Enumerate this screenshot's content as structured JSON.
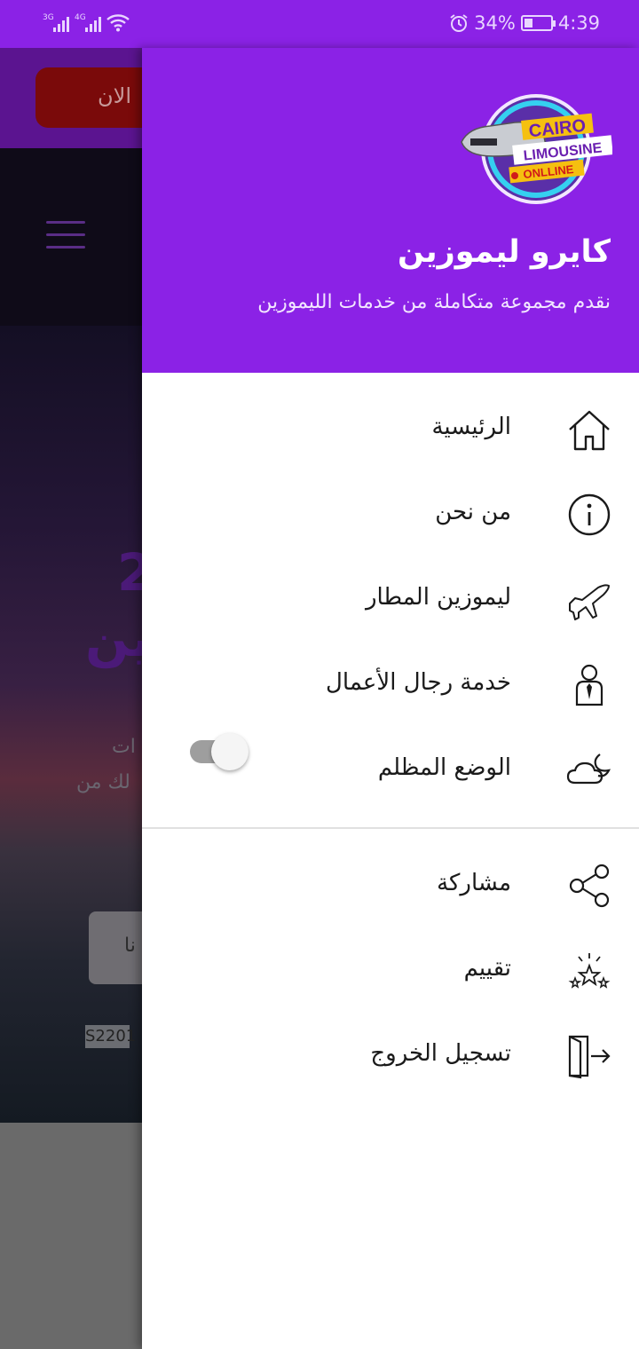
{
  "status_bar": {
    "signal1_type": "3G",
    "signal2_type": "4G",
    "battery_percent": "34%",
    "battery_level": 0.34,
    "time": "4:39"
  },
  "background_app": {
    "cta_text": "الان",
    "hero_partial_1": "2",
    "hero_partial_2": "ين",
    "text_partial_1": "ات",
    "text_partial_2": "لك من",
    "button_partial": "نا",
    "sign_text": "S2201"
  },
  "drawer": {
    "logo": {
      "line1": "CAIRO",
      "line2": "LIMOUSINE",
      "line3": "ONLLINE"
    },
    "title": "كايرو ليموزين",
    "subtitle": "نقدم مجموعة متكاملة من خدمات الليموزين",
    "items": [
      {
        "label": "الرئيسية",
        "icon": "home-icon"
      },
      {
        "label": "من نحن",
        "icon": "info-icon"
      },
      {
        "label": "ليموزين المطار",
        "icon": "airplane-icon"
      },
      {
        "label": "خدمة رجال الأعمال",
        "icon": "businessman-icon"
      },
      {
        "label": "الوضع المظلم",
        "icon": "night-cloud-icon",
        "toggle": false
      }
    ],
    "secondary_items": [
      {
        "label": "مشاركة",
        "icon": "share-icon"
      },
      {
        "label": "تقييم",
        "icon": "rate-stars-icon"
      },
      {
        "label": "تسجيل الخروج",
        "icon": "logout-icon"
      }
    ]
  },
  "colors": {
    "primary": "#8b22e6",
    "text": "#1a1a1a",
    "toggle_off": "#9e9e9e"
  }
}
